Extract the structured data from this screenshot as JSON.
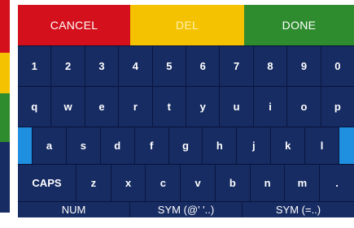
{
  "actions": {
    "cancel_label": "CANCEL",
    "del_label": "DEL",
    "done_label": "DONE"
  },
  "rows": {
    "numbers": [
      "1",
      "2",
      "3",
      "4",
      "5",
      "6",
      "7",
      "8",
      "9",
      "0"
    ],
    "qwerty": [
      "q",
      "w",
      "e",
      "r",
      "t",
      "y",
      "u",
      "i",
      "o",
      "p"
    ],
    "asdf": [
      "a",
      "s",
      "d",
      "f",
      "g",
      "h",
      "j",
      "k",
      "l"
    ],
    "zxcv": [
      "CAPS",
      "z",
      "x",
      "c",
      "v",
      "b",
      "n",
      "m",
      "."
    ],
    "bottom": [
      "NUM",
      "SYM (@' '..)",
      "SYM (=..)"
    ]
  },
  "colors": {
    "cancel": "#d3101b",
    "del": "#f4c200",
    "done": "#2e8b2e",
    "key_bg": "#172c63",
    "accent_blue": "#1f8fe0"
  }
}
